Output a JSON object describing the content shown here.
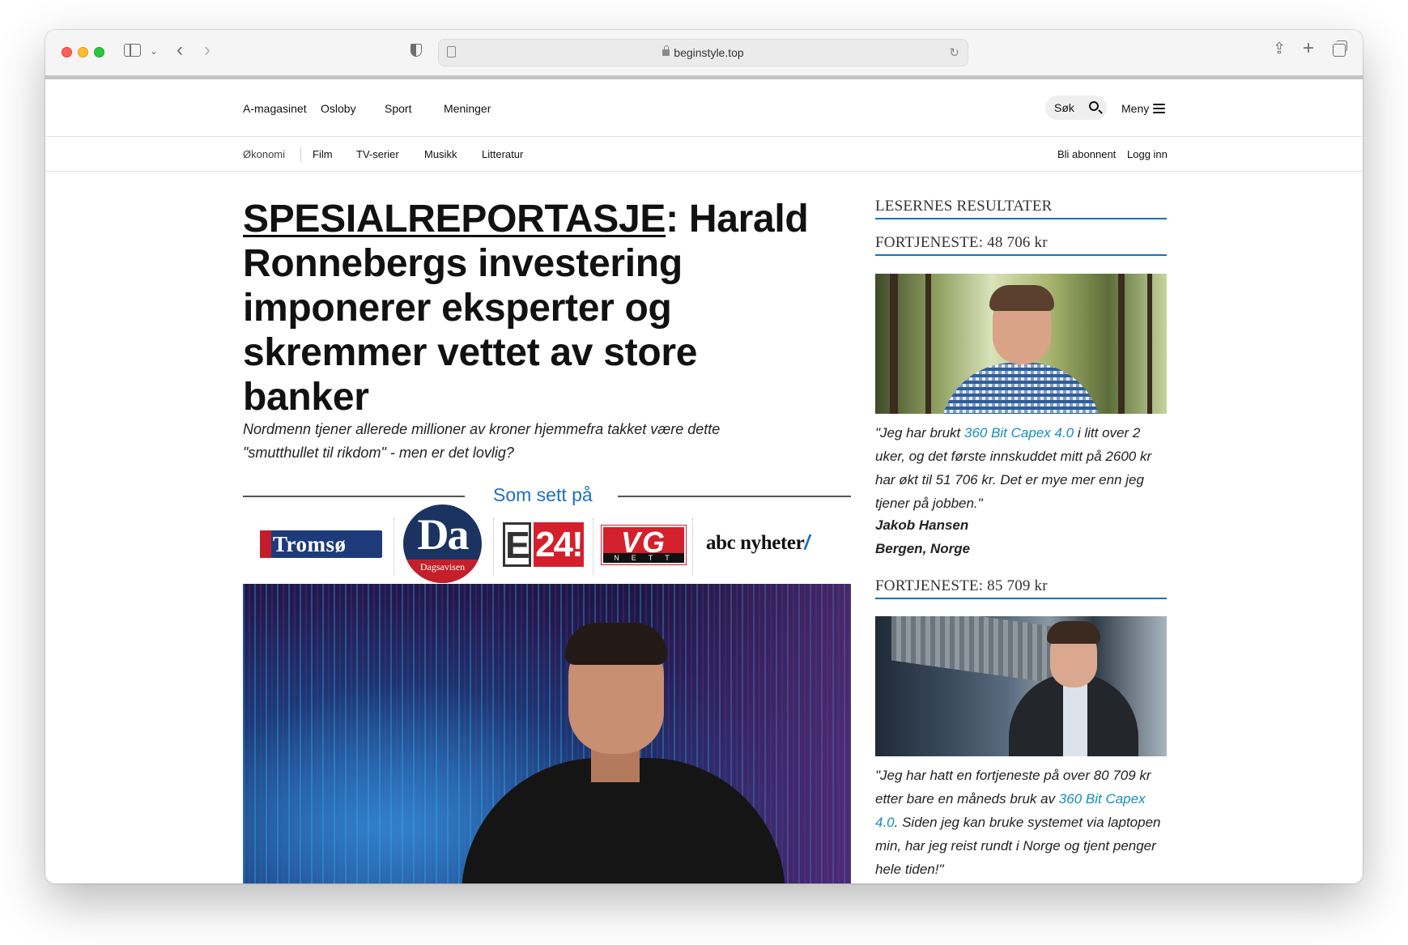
{
  "browser": {
    "url": "beginstyle.top"
  },
  "nav_primary": {
    "items": [
      "A-magasinet",
      "Osloby",
      "Sport",
      "Meninger"
    ],
    "search_label": "Søk",
    "menu_label": "Meny"
  },
  "nav_secondary": {
    "items": [
      "Økonomi",
      "Film",
      "TV-serier",
      "Musikk",
      "Litteratur"
    ],
    "subscribe_label": "Bli abonnent",
    "login_label": "Logg inn"
  },
  "article": {
    "kicker": "SPESIALREPORTASJE",
    "headline_rest": ": Harald Ronnebergs investering imponerer eksperter og skremmer vettet av store banker",
    "lead": "Nordmenn tjener allerede millioner av kroner hjemmefra takket være dette \"smutthullet til rikdom\" - men er det lovlig?",
    "seen_on_label": "Som sett på",
    "logos": {
      "itromso": "Tromsø",
      "itromso_i": "i",
      "da": "Da",
      "da_sub": "Dagsavisen",
      "e24_e": "E",
      "e24_n": "24!",
      "vg": "VG",
      "vg_nett": "NETT",
      "abc": "abc nyheter",
      "abc_slash": "/"
    }
  },
  "sidebar": {
    "title": "LESERNES RESULTATER",
    "testimonials": [
      {
        "profit": "FORTJENESTE: 48 706 kr",
        "quote_before": "\"Jeg har brukt ",
        "link": "360 Bit Capex 4.0",
        "quote_after": " i litt over 2 uker, og det første innskuddet mitt på 2600 kr har økt til 51 706 kr. Det er mye mer enn jeg tjener på jobben.\"",
        "name": "Jakob Hansen",
        "location": "Bergen, Norge"
      },
      {
        "profit": "FORTJENESTE: 85 709 kr",
        "quote_before": "\"Jeg har hatt en fortjeneste på over 80 709 kr etter bare en måneds bruk av ",
        "link": "360 Bit Capex 4.0",
        "quote_after": ". Siden jeg kan bruke systemet via laptopen min, har jeg reist rundt i Norge og tjent penger hele tiden!\""
      }
    ]
  },
  "colors": {
    "link": "#1a8bb8",
    "accent_blue": "#1a73b5",
    "headline": "#111111"
  }
}
